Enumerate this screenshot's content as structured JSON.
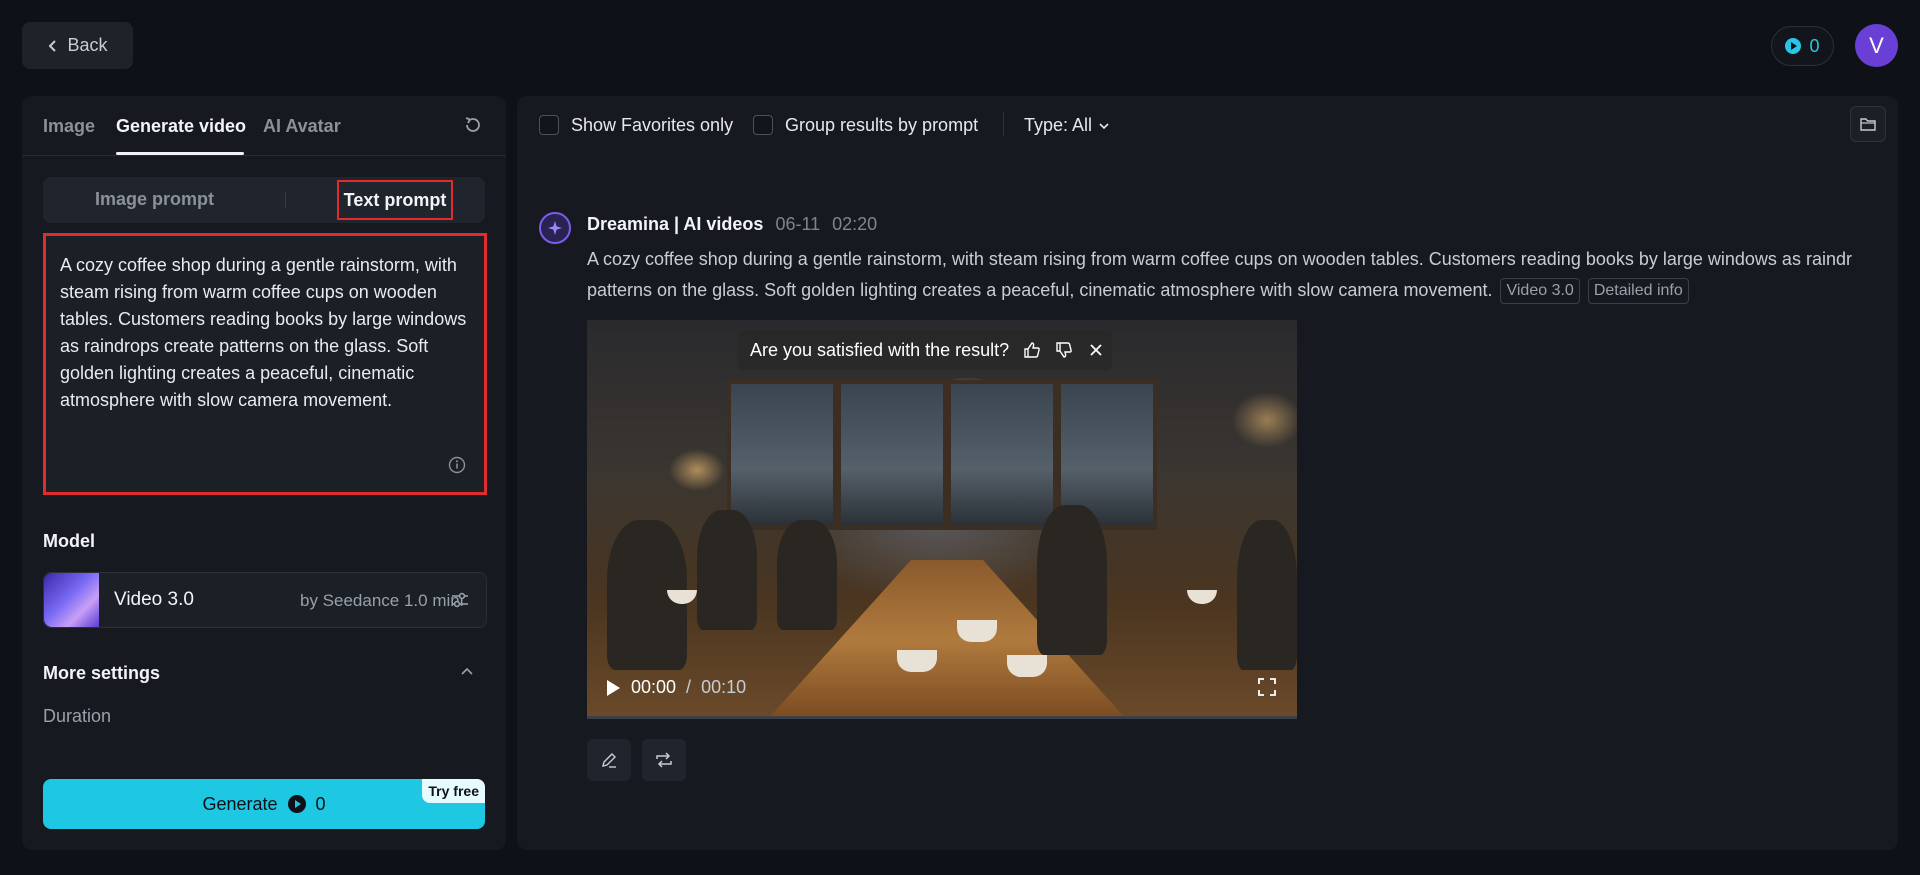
{
  "header": {
    "back_label": "Back",
    "credits": "0",
    "avatar_initial": "V"
  },
  "left": {
    "tabs": [
      {
        "label": "Image"
      },
      {
        "label": "Generate video",
        "active": true
      },
      {
        "label": "AI Avatar"
      }
    ],
    "prompt_modes": {
      "image": "Image prompt",
      "text": "Text prompt",
      "active": "Text prompt"
    },
    "prompt_text": "A cozy coffee shop during a gentle rainstorm, with steam rising from warm coffee cups on wooden tables. Customers reading books by large windows as raindrops create patterns on the glass. Soft golden lighting creates a peaceful, cinematic atmosphere with slow camera movement.",
    "model_section": "Model",
    "model": {
      "name": "Video 3.0",
      "by": "by Seedance 1.0 mini"
    },
    "more_settings": "More settings",
    "duration_label": "Duration",
    "generate": {
      "label": "Generate",
      "cost": "0",
      "badge": "Try free"
    }
  },
  "right": {
    "filters": {
      "favorites": "Show Favorites only",
      "group": "Group results by prompt",
      "type": "Type: All"
    },
    "post": {
      "author": "Dreamina | AI videos",
      "date": "06-11",
      "time": "02:20",
      "text_line1": "A cozy coffee shop during a gentle rainstorm, with steam rising from warm coffee cups on wooden tables. Customers reading books by large windows as raindr",
      "text_line2": "patterns on the glass. Soft golden lighting creates a peaceful, cinematic atmosphere with slow camera movement.",
      "tags": [
        "Video 3.0",
        "Detailed info"
      ],
      "feedback_question": "Are you satisfied with the result?",
      "time_current": "00:00",
      "time_separator": "/",
      "time_total": "00:10"
    }
  },
  "colors": {
    "accent": "#1ec8e3",
    "highlight": "#e02c2c",
    "brand": "#6a3fd6"
  }
}
